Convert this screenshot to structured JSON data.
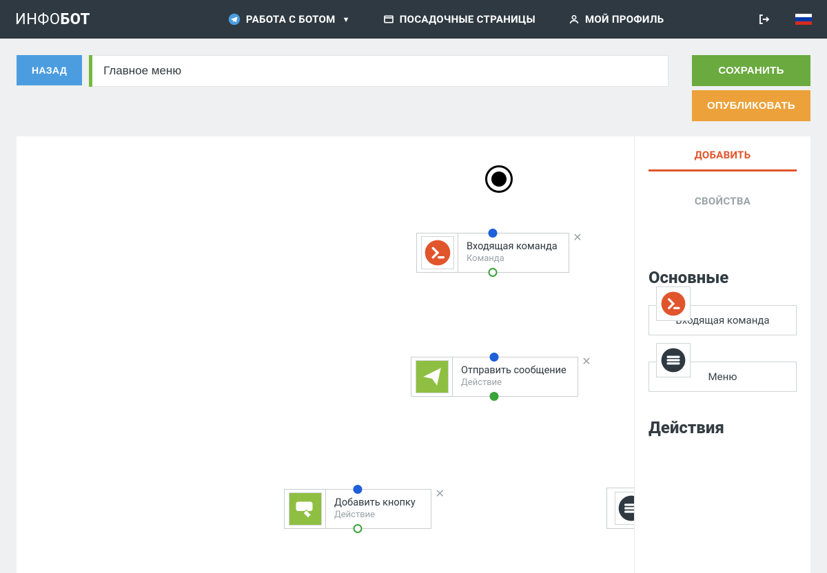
{
  "brand": {
    "thin": "ИНФО",
    "bold": "БОТ"
  },
  "nav": {
    "bot": "РАБОТА С БОТОМ",
    "landing": "ПОСАДОЧНЫЕ СТРАНИЦЫ",
    "profile": "МОЙ ПРОФИЛЬ"
  },
  "toolbar": {
    "back": "НАЗАД",
    "pageName": "Главное меню",
    "save": "СОХРАНИТЬ",
    "publish": "ОПУБЛИКОВАТЬ"
  },
  "sidebar": {
    "tab_add": "ДОБАВИТЬ",
    "tab_props": "СВОЙСТВА",
    "section_main": "Основные",
    "section_actions": "Действия",
    "item_incoming": "Входящая команда",
    "item_menu": "Меню"
  },
  "canvas": {
    "nodes": {
      "incoming": {
        "title": "Входящая команда",
        "sub": "Команда"
      },
      "send": {
        "title": "Отправить сообщение",
        "sub": "Действие"
      },
      "addbtn": {
        "title": "Добавить кнопку",
        "sub": "Действие"
      }
    }
  },
  "colors": {
    "orange": "#e1552c",
    "green": "#8fbf42",
    "dark": "#2f3941"
  }
}
